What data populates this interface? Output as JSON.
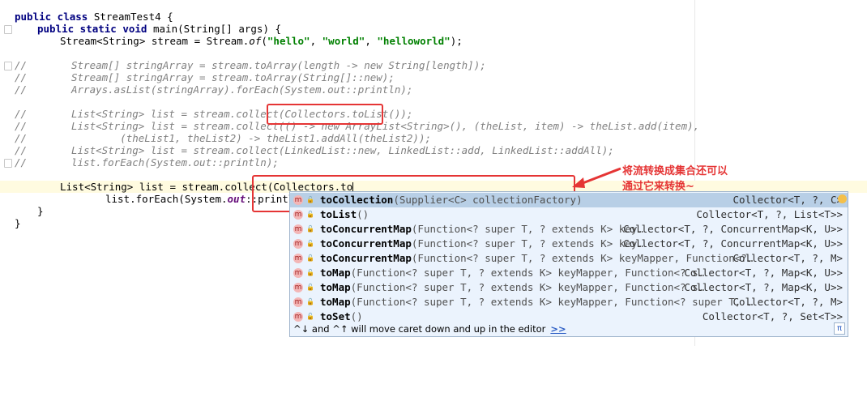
{
  "editor": {
    "class_decl": {
      "kw": "public class",
      "name": " StreamTest4 {"
    },
    "main_decl": {
      "kw1": "public static void",
      "rest": " main(String[] args) {"
    },
    "stream_decl": {
      "pre": "Stream<String> stream = Stream.",
      "of": "of",
      "open": "(",
      "s1": "\"hello\"",
      "c1": ", ",
      "s2": "\"world\"",
      "c2": ", ",
      "s3": "\"helloworld\"",
      "close": ");"
    },
    "comments": [
      {
        "slash": "//",
        "text": "Stream[] stringArray = stream.toArray(length -> new String[length]);"
      },
      {
        "slash": "//",
        "text": "Stream[] stringArray = stream.toArray(String[]::new);"
      },
      {
        "slash": "//",
        "text": "Arrays.asList(stringArray).forEach(System.out::println);"
      },
      {
        "slash": "//",
        "text": "List<String> list = stream.collect(Collectors.toList());"
      },
      {
        "slash": "//",
        "text": "List<String> list = stream.collect(() -> new ArrayList<String>(), (theList, item) -> theList.add(item),"
      },
      {
        "slash": "//",
        "text": "        (theList1, theList2) -> theList1.addAll(theList2));"
      },
      {
        "slash": "//",
        "text": "List<String> list = stream.collect(LinkedList::new, LinkedList::add, LinkedList::addAll);"
      },
      {
        "slash": "//",
        "text": "list.forEach(System.out::println);"
      }
    ],
    "current_line": "List<String> list = stream.collect(Collectors.to",
    "foreach_line": {
      "pre": "list.forEach(System.",
      "out": "out",
      "post": "::println)"
    },
    "close1": "}",
    "close2": "}"
  },
  "annotation": {
    "line1": "将流转换成集合还可以",
    "line2": "通过它来转换~"
  },
  "completion": {
    "items": [
      {
        "name": "toCollection",
        "sig": "(Supplier<C> collectionFactory)",
        "ret": "Collector<T, ?, C>"
      },
      {
        "name": "toList",
        "sig": "()",
        "ret": "Collector<T, ?, List<T>>"
      },
      {
        "name": "toConcurrentMap",
        "sig": "(Function<? super T, ? extends K> key…",
        "ret": "Collector<T, ?, ConcurrentMap<K, U>>"
      },
      {
        "name": "toConcurrentMap",
        "sig": "(Function<? super T, ? extends K> key…",
        "ret": "Collector<T, ?, ConcurrentMap<K, U>>"
      },
      {
        "name": "toConcurrentMap",
        "sig": "(Function<? super T, ? extends K> keyMapper, Function<?…",
        "ret": "Collector<T, ?, M>"
      },
      {
        "name": "toMap",
        "sig": "(Function<? super T, ? extends K> keyMapper, Function<? s…",
        "ret": "Collector<T, ?, Map<K, U>>"
      },
      {
        "name": "toMap",
        "sig": "(Function<? super T, ? extends K> keyMapper, Function<? s…",
        "ret": "Collector<T, ?, Map<K, U>>"
      },
      {
        "name": "toMap",
        "sig": "(Function<? super T, ? extends K> keyMapper, Function<? super T, …",
        "ret": "Collector<T, ?, M>"
      },
      {
        "name": "toSet",
        "sig": "()",
        "ret": "Collector<T, ?, Set<T>>"
      }
    ],
    "footer_text": "^↓ and ^↑ will move caret down and up in the editor",
    "footer_link": ">>",
    "pi_symbol": "π",
    "method_icon": "m"
  },
  "colors": {
    "highlight_red": "#e53535",
    "popup_bg": "#ebf3fd",
    "selected_row": "#b8cfe6"
  }
}
